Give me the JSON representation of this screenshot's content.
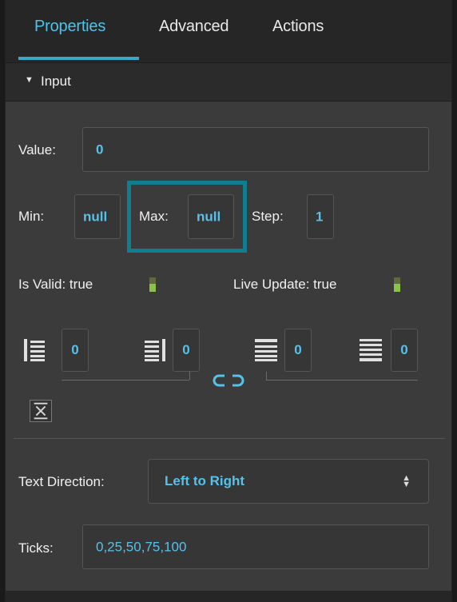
{
  "tabs": [
    {
      "label": "Properties",
      "active": true
    },
    {
      "label": "Advanced",
      "active": false
    },
    {
      "label": "Actions",
      "active": false
    }
  ],
  "section": {
    "title": "Input",
    "expanded": true
  },
  "value": {
    "label": "Value:",
    "value": "0"
  },
  "min": {
    "label": "Min:",
    "value": "null"
  },
  "max": {
    "label": "Max:",
    "value": "null"
  },
  "step": {
    "label": "Step:",
    "value": "1"
  },
  "is_valid": {
    "label": "Is Valid: true",
    "state": true
  },
  "live_update": {
    "label": "Live Update: true",
    "state": true
  },
  "padding": {
    "left": "0",
    "right": "0",
    "top": "0",
    "bottom": "0"
  },
  "text_direction": {
    "label": "Text Direction:",
    "value": "Left to Right"
  },
  "ticks": {
    "label": "Ticks:",
    "value": "0,25,50,75,100"
  },
  "colors": {
    "accent": "#4fc3e8",
    "highlight": "#0f7e8f",
    "toggle_on": "#8bc34a",
    "panel_bg": "#3b3b3b"
  },
  "icons": {
    "section_caret": "caret-down-icon",
    "pad_left": "align-left-padding-icon",
    "pad_right": "align-right-padding-icon",
    "pad_top": "align-top-padding-icon",
    "pad_bottom": "align-bottom-padding-icon",
    "link": "link-icon",
    "collapse": "collapse-icon",
    "select_arrows": "updown-arrows-icon"
  }
}
